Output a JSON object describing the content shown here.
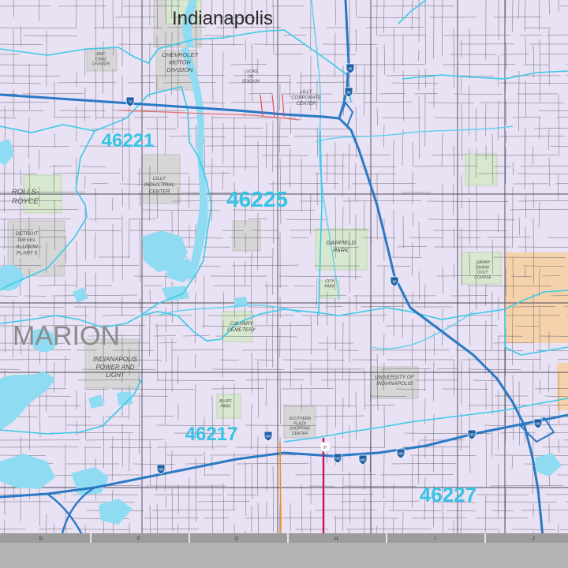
{
  "city_label": "Indianapolis",
  "county_label": "MARION",
  "zip_codes": [
    "46221",
    "46225",
    "46217",
    "46227"
  ],
  "landmarks": {
    "chevrolet": [
      "CHEVROLET",
      "MOTOR",
      "DIVISION"
    ],
    "emc": [
      "EMC",
      "CHAZ",
      "DIVISION"
    ],
    "lucas": [
      "LUCAS",
      "OIL",
      "STADIUM"
    ],
    "lilly_corp": [
      "LILLY",
      "CORPORATE",
      "CENTER"
    ],
    "lilly_ind": [
      "LILLY",
      "INDUSTRIAL",
      "CENTER"
    ],
    "rolls": [
      "ROLLS-",
      "ROYCE"
    ],
    "detroit": [
      "DETROIT",
      "DIESEL",
      "ALLISON",
      "PLANT 5"
    ],
    "garfield": [
      "GARFIELD",
      "PARK"
    ],
    "sarah_shank": [
      "SARAH",
      "SHANK",
      "GOLF",
      "COURSE"
    ],
    "calvary": [
      "CALVARY",
      "CEMETERY"
    ],
    "ipl": [
      "INDIANAPOLIS",
      "POWER AND",
      "LIGHT"
    ],
    "uindy": [
      "UNIVERSITY OF",
      "INDIANAPOLIS"
    ],
    "southern_plaza": [
      "SOUTHERN",
      "PLAZA",
      "SHOPPING",
      "CENTER"
    ],
    "bluff_park": [
      "BLUFF",
      "PARK"
    ],
    "city_park": [
      "CITY",
      "PARK"
    ]
  },
  "interstate_shields": [
    "70",
    "65",
    "465",
    "37"
  ],
  "grid_letters": [
    "E",
    "F",
    "G",
    "H",
    "I",
    "J"
  ],
  "colors": {
    "background": "#e9e1f4",
    "water": "#8fdcf2",
    "zip_boundary": "#3cc9e8",
    "interstate": "#2a79c4",
    "highway": "#c2185b",
    "industrial": "#d6d6d6",
    "park": "#d8e8cf",
    "orange_zone": "#f6d2ac",
    "zip_label": "#35c3e6"
  }
}
